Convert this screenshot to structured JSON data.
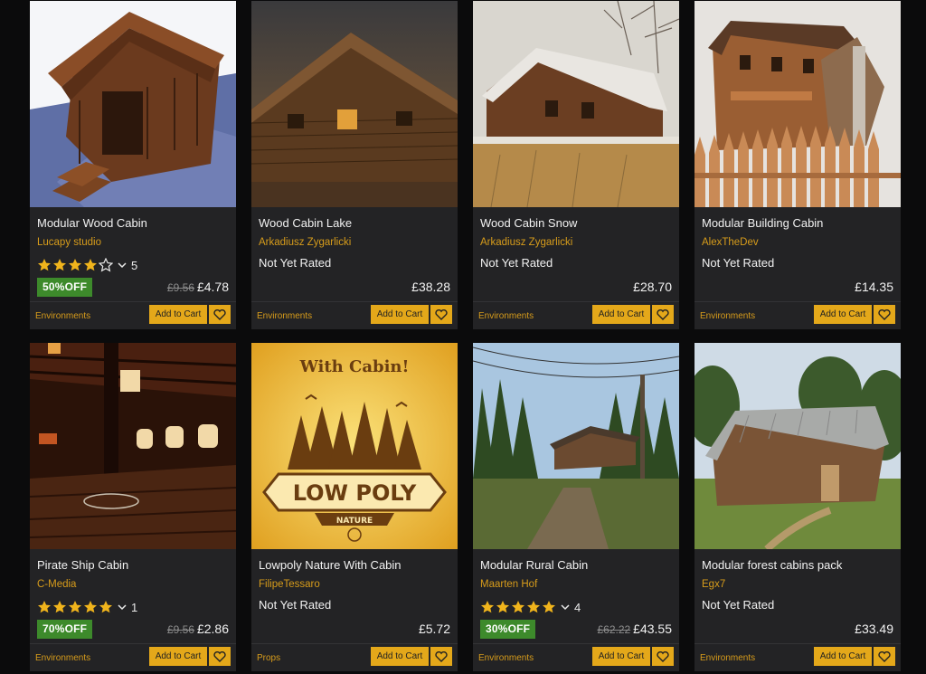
{
  "colors": {
    "background": "#0b0b0c",
    "card": "#232325",
    "accent": "#e4a81a",
    "publisher": "#d79c1b",
    "sale_badge": "#3d8a2b",
    "star": "#f0b41c"
  },
  "products": [
    {
      "title": "Modular Wood Cabin",
      "publisher": "Lucapy studio",
      "rating": 4,
      "rating_count": "5",
      "rating_text": "",
      "discount": "50%OFF",
      "old_price": "£9.56",
      "price": "£4.78",
      "category": "Environments",
      "cart_label": "Add to Cart",
      "wishlist_icon": "heart-icon"
    },
    {
      "title": "Wood Cabin Lake",
      "publisher": "Arkadiusz Zygarlicki",
      "rating": 0,
      "rating_count": "",
      "rating_text": "Not Yet Rated",
      "discount": "",
      "old_price": "",
      "price": "£38.28",
      "category": "Environments",
      "cart_label": "Add to Cart",
      "wishlist_icon": "heart-icon"
    },
    {
      "title": "Wood Cabin Snow",
      "publisher": "Arkadiusz Zygarlicki",
      "rating": 0,
      "rating_count": "",
      "rating_text": "Not Yet Rated",
      "discount": "",
      "old_price": "",
      "price": "£28.70",
      "category": "Environments",
      "cart_label": "Add to Cart",
      "wishlist_icon": "heart-icon"
    },
    {
      "title": "Modular Building Cabin",
      "publisher": "AlexTheDev",
      "rating": 0,
      "rating_count": "",
      "rating_text": "Not Yet Rated",
      "discount": "",
      "old_price": "",
      "price": "£14.35",
      "category": "Environments",
      "cart_label": "Add to Cart",
      "wishlist_icon": "heart-icon"
    },
    {
      "title": "Pirate Ship Cabin",
      "publisher": "C-Media",
      "rating": 5,
      "rating_count": "1",
      "rating_text": "",
      "discount": "70%OFF",
      "old_price": "£9.56",
      "price": "£2.86",
      "category": "Environments",
      "cart_label": "Add to Cart",
      "wishlist_icon": "heart-icon"
    },
    {
      "title": "Lowpoly Nature With Cabin",
      "publisher": "FilipeTessaro",
      "rating": 0,
      "rating_count": "",
      "rating_text": "Not Yet Rated",
      "discount": "",
      "old_price": "",
      "price": "£5.72",
      "category": "Props",
      "cart_label": "Add to Cart",
      "wishlist_icon": "heart-icon",
      "thumb_text_top": "With Cabin!",
      "thumb_text_main": "LOW POLY",
      "thumb_text_sub": "NATURE"
    },
    {
      "title": "Modular Rural Cabin",
      "publisher": "Maarten Hof",
      "rating": 5,
      "rating_count": "4",
      "rating_text": "",
      "discount": "30%OFF",
      "old_price": "£62.22",
      "price": "£43.55",
      "category": "Environments",
      "cart_label": "Add to Cart",
      "wishlist_icon": "heart-icon"
    },
    {
      "title": "Modular forest cabins pack",
      "publisher": "Egx7",
      "rating": 0,
      "rating_count": "",
      "rating_text": "Not Yet Rated",
      "discount": "",
      "old_price": "",
      "price": "£33.49",
      "category": "Environments",
      "cart_label": "Add to Cart",
      "wishlist_icon": "heart-icon"
    }
  ]
}
